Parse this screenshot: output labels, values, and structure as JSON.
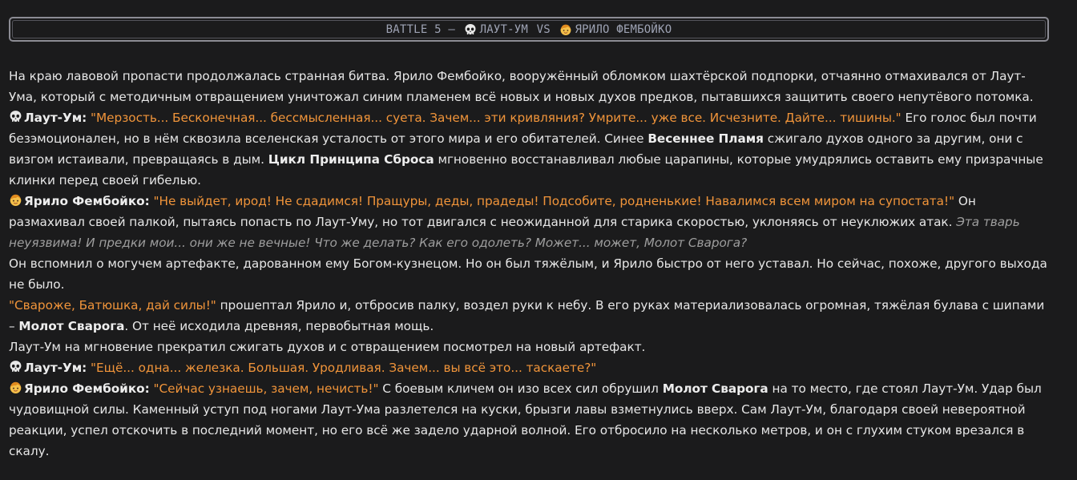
{
  "header": {
    "prefix": "BATTLE 5 – ",
    "fighter1": "ЛАУТ-УМ",
    "vs": " VS ",
    "fighter2": "ЯРИЛО ФЕМБОЙКО"
  },
  "icons": {
    "laut": "skull-icon",
    "yarilo": "child-face-icon"
  },
  "colors": {
    "quote": "#f0943a",
    "thought": "#9e9e9e",
    "background": "#1b1b1c"
  },
  "story": {
    "p1": "На краю лавовой пропасти продолжалась странная битва. Ярило Фембойко, вооружённый обломком шахтёрской подпорки, отчаянно отмахивался от Лаут-Ума, который с методичным отвращением уничтожал синим пламенем всё новых и новых духов предков, пытавшихся защитить своего непутёвого потомка.",
    "p2_name": "Лаут-Ум:",
    "p2_quote": "\"Мерзость... Бесконечная... бессмысленная... суета. Зачем... эти кривляния? Умрите... уже все. Исчезните. Дайте... тишины.\"",
    "p2_t1": " Его голос был почти безэмоционален, но в нём сквозила вселенская усталость от этого мира и его обитателей. Синее ",
    "p2_b1": "Весеннее Пламя",
    "p2_t2": " сжигало духов одного за другим, они с визгом истаивали, превращаясь в дым. ",
    "p2_b2": "Цикл Принципа Сброса",
    "p2_t3": " мгновенно восстанавливал любые царапины, которые умудрялись оставить ему призрачные клинки перед своей гибелью.",
    "p3_name": "Ярило Фембойко:",
    "p3_quote": "\"Не выйдет, ирод! Не сдадимся! Пращуры, деды, прадеды! Подсобите, родненькие! Навалимся всем миром на супостата!\"",
    "p3_t1": " Он размахивал своей палкой, пытаясь попасть по Лаут-Уму, но тот двигался с неожиданной для старика скоростью, уклоняясь от неуклюжих атак. ",
    "p3_thought": "Эта тварь неуязвима! И предки мои... они же не вечные! Что же делать? Как его одолеть? Может... может, Молот Сварога?",
    "p4": "Он вспомнил о могучем артефакте, дарованном ему Богом-кузнецом. Но он был тяжёлым, и Ярило быстро от него уставал. Но сейчас, похоже, другого выхода не было.",
    "p5_quote": "\"Свароже, Батюшка, дай силы!\"",
    "p5_t1": " прошептал Ярило и, отбросив палку, воздел руки к небу. В его руках материализовалась огромная, тяжёлая булава с шипами – ",
    "p5_b1": "Молот Сварога",
    "p5_t2": ". От неё исходила древняя, первобытная мощь.",
    "p6": "Лаут-Ум на мгновение прекратил сжигать духов и с отвращением посмотрел на новый артефакт.",
    "p7_name": "Лаут-Ум:",
    "p7_quote": "\"Ещё... одна... железка. Большая. Уродливая. Зачем... вы всё это... таскаете?\"",
    "p8_name": "Ярило Фембойко:",
    "p8_quote": "\"Сейчас узнаешь, зачем, нечисть!\"",
    "p8_t1": " С боевым кличем он изо всех сил обрушил ",
    "p8_b1": "Молот Сварога",
    "p8_t2": " на то место, где стоял Лаут-Ум. Удар был чудовищной силы. Каменный уступ под ногами Лаут-Ума разлетелся на куски, брызги лавы взметнулись вверх. Сам Лаут-Ум, благодаря своей невероятной реакции, успел отскочить в последний момент, но его всё же задело ударной волной. Его отбросило на несколько метров, и он с глухим стуком врезался в скалу."
  }
}
